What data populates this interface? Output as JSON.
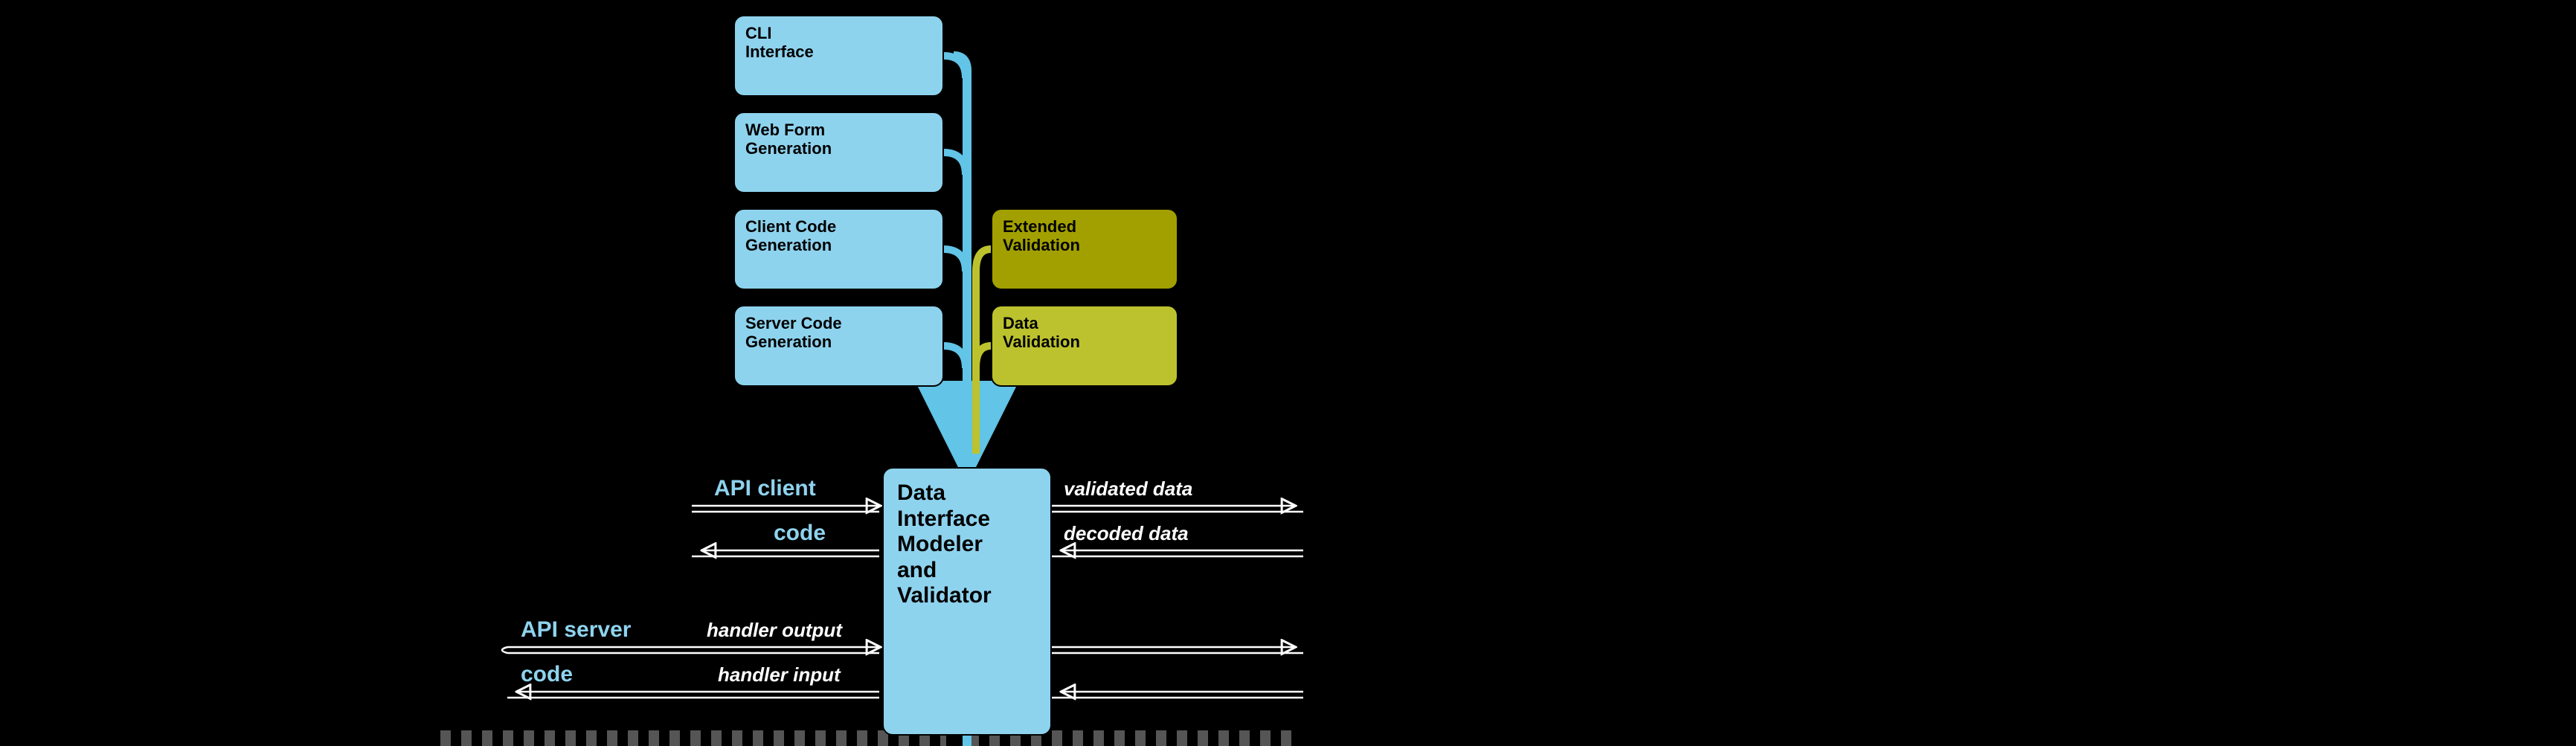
{
  "nodes": {
    "cli": {
      "l1": "CLI",
      "l2": "Interface"
    },
    "webform": {
      "l1": "Web Form",
      "l2": "Generation"
    },
    "clientcode": {
      "l1": "Client Code",
      "l2": "Generation"
    },
    "servercode": {
      "l1": "Server Code",
      "l2": "Generation"
    },
    "extval": {
      "l1": "Extended",
      "l2": "Validation"
    },
    "dataval": {
      "l1": "Data",
      "l2": "Validation"
    },
    "core": {
      "l1": "Data",
      "l2": "Interface",
      "l3": "Modeler",
      "l4": "and",
      "l5": "Validator"
    }
  },
  "labels": {
    "api_client": "API client",
    "code1": "code",
    "api_server": "API server",
    "code2": "code",
    "handler_output": "handler output",
    "handler_input": "handler input",
    "validated_data": "validated data",
    "decoded_data": "decoded data"
  },
  "colors": {
    "blue": "#8ed3ee",
    "oliveD": "#a2a000",
    "oliveL": "#bcc22e",
    "arrow": "#fefefe",
    "spine": "#62c4e6"
  }
}
